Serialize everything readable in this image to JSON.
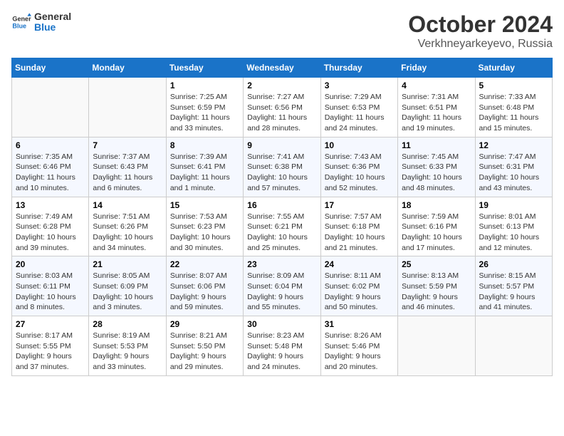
{
  "header": {
    "logo_general": "General",
    "logo_blue": "Blue",
    "title": "October 2024",
    "subtitle": "Verkhneyarkeyevo, Russia"
  },
  "weekdays": [
    "Sunday",
    "Monday",
    "Tuesday",
    "Wednesday",
    "Thursday",
    "Friday",
    "Saturday"
  ],
  "weeks": [
    [
      {
        "day": "",
        "info": ""
      },
      {
        "day": "",
        "info": ""
      },
      {
        "day": "1",
        "info": "Sunrise: 7:25 AM\nSunset: 6:59 PM\nDaylight: 11 hours\nand 33 minutes."
      },
      {
        "day": "2",
        "info": "Sunrise: 7:27 AM\nSunset: 6:56 PM\nDaylight: 11 hours\nand 28 minutes."
      },
      {
        "day": "3",
        "info": "Sunrise: 7:29 AM\nSunset: 6:53 PM\nDaylight: 11 hours\nand 24 minutes."
      },
      {
        "day": "4",
        "info": "Sunrise: 7:31 AM\nSunset: 6:51 PM\nDaylight: 11 hours\nand 19 minutes."
      },
      {
        "day": "5",
        "info": "Sunrise: 7:33 AM\nSunset: 6:48 PM\nDaylight: 11 hours\nand 15 minutes."
      }
    ],
    [
      {
        "day": "6",
        "info": "Sunrise: 7:35 AM\nSunset: 6:46 PM\nDaylight: 11 hours\nand 10 minutes."
      },
      {
        "day": "7",
        "info": "Sunrise: 7:37 AM\nSunset: 6:43 PM\nDaylight: 11 hours\nand 6 minutes."
      },
      {
        "day": "8",
        "info": "Sunrise: 7:39 AM\nSunset: 6:41 PM\nDaylight: 11 hours\nand 1 minute."
      },
      {
        "day": "9",
        "info": "Sunrise: 7:41 AM\nSunset: 6:38 PM\nDaylight: 10 hours\nand 57 minutes."
      },
      {
        "day": "10",
        "info": "Sunrise: 7:43 AM\nSunset: 6:36 PM\nDaylight: 10 hours\nand 52 minutes."
      },
      {
        "day": "11",
        "info": "Sunrise: 7:45 AM\nSunset: 6:33 PM\nDaylight: 10 hours\nand 48 minutes."
      },
      {
        "day": "12",
        "info": "Sunrise: 7:47 AM\nSunset: 6:31 PM\nDaylight: 10 hours\nand 43 minutes."
      }
    ],
    [
      {
        "day": "13",
        "info": "Sunrise: 7:49 AM\nSunset: 6:28 PM\nDaylight: 10 hours\nand 39 minutes."
      },
      {
        "day": "14",
        "info": "Sunrise: 7:51 AM\nSunset: 6:26 PM\nDaylight: 10 hours\nand 34 minutes."
      },
      {
        "day": "15",
        "info": "Sunrise: 7:53 AM\nSunset: 6:23 PM\nDaylight: 10 hours\nand 30 minutes."
      },
      {
        "day": "16",
        "info": "Sunrise: 7:55 AM\nSunset: 6:21 PM\nDaylight: 10 hours\nand 25 minutes."
      },
      {
        "day": "17",
        "info": "Sunrise: 7:57 AM\nSunset: 6:18 PM\nDaylight: 10 hours\nand 21 minutes."
      },
      {
        "day": "18",
        "info": "Sunrise: 7:59 AM\nSunset: 6:16 PM\nDaylight: 10 hours\nand 17 minutes."
      },
      {
        "day": "19",
        "info": "Sunrise: 8:01 AM\nSunset: 6:13 PM\nDaylight: 10 hours\nand 12 minutes."
      }
    ],
    [
      {
        "day": "20",
        "info": "Sunrise: 8:03 AM\nSunset: 6:11 PM\nDaylight: 10 hours\nand 8 minutes."
      },
      {
        "day": "21",
        "info": "Sunrise: 8:05 AM\nSunset: 6:09 PM\nDaylight: 10 hours\nand 3 minutes."
      },
      {
        "day": "22",
        "info": "Sunrise: 8:07 AM\nSunset: 6:06 PM\nDaylight: 9 hours\nand 59 minutes."
      },
      {
        "day": "23",
        "info": "Sunrise: 8:09 AM\nSunset: 6:04 PM\nDaylight: 9 hours\nand 55 minutes."
      },
      {
        "day": "24",
        "info": "Sunrise: 8:11 AM\nSunset: 6:02 PM\nDaylight: 9 hours\nand 50 minutes."
      },
      {
        "day": "25",
        "info": "Sunrise: 8:13 AM\nSunset: 5:59 PM\nDaylight: 9 hours\nand 46 minutes."
      },
      {
        "day": "26",
        "info": "Sunrise: 8:15 AM\nSunset: 5:57 PM\nDaylight: 9 hours\nand 41 minutes."
      }
    ],
    [
      {
        "day": "27",
        "info": "Sunrise: 8:17 AM\nSunset: 5:55 PM\nDaylight: 9 hours\nand 37 minutes."
      },
      {
        "day": "28",
        "info": "Sunrise: 8:19 AM\nSunset: 5:53 PM\nDaylight: 9 hours\nand 33 minutes."
      },
      {
        "day": "29",
        "info": "Sunrise: 8:21 AM\nSunset: 5:50 PM\nDaylight: 9 hours\nand 29 minutes."
      },
      {
        "day": "30",
        "info": "Sunrise: 8:23 AM\nSunset: 5:48 PM\nDaylight: 9 hours\nand 24 minutes."
      },
      {
        "day": "31",
        "info": "Sunrise: 8:26 AM\nSunset: 5:46 PM\nDaylight: 9 hours\nand 20 minutes."
      },
      {
        "day": "",
        "info": ""
      },
      {
        "day": "",
        "info": ""
      }
    ]
  ]
}
